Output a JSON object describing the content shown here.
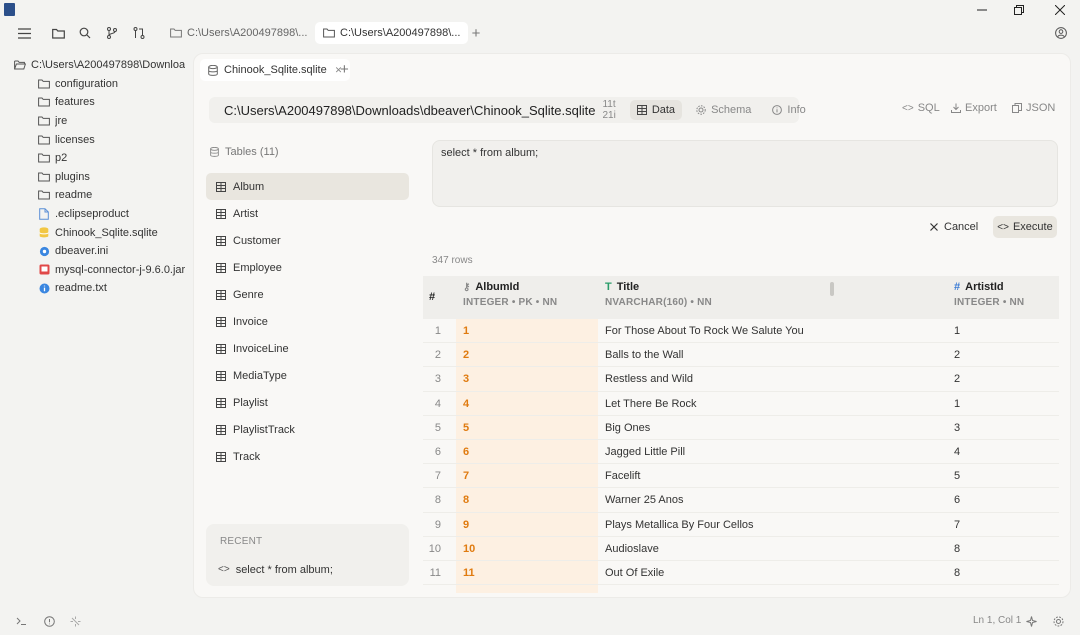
{
  "window": {
    "minimize": "–",
    "maximize": "❐",
    "close": "✕"
  },
  "toolbar": {
    "path_tabs": [
      {
        "label": "C:\\Users\\A200497898\\..."
      },
      {
        "label": "C:\\Users\\A200497898\\..."
      }
    ],
    "new_tab": "+"
  },
  "tree": {
    "root": "C:\\Users\\A200497898\\Downloa",
    "items": [
      {
        "label": "configuration",
        "icon": "folder-icon"
      },
      {
        "label": "features",
        "icon": "folder-icon"
      },
      {
        "label": "jre",
        "icon": "folder-icon"
      },
      {
        "label": "licenses",
        "icon": "folder-icon"
      },
      {
        "label": "p2",
        "icon": "folder-icon"
      },
      {
        "label": "plugins",
        "icon": "folder-icon"
      },
      {
        "label": "readme",
        "icon": "folder-icon"
      },
      {
        "label": ".eclipseproduct",
        "icon": "file-icon"
      },
      {
        "label": "Chinook_Sqlite.sqlite",
        "icon": "database-file-icon"
      },
      {
        "label": "dbeaver.ini",
        "icon": "settings-file-icon"
      },
      {
        "label": "mysql-connector-j-9.6.0.jar",
        "icon": "jar-file-icon"
      },
      {
        "label": "readme.txt",
        "icon": "info-file-icon"
      }
    ]
  },
  "doc": {
    "tab_label": "Chinook_Sqlite.sqlite",
    "tab_close": "✕",
    "new_tab": "+",
    "path": "C:\\Users\\A200497898\\Downloads\\dbeaver\\Chinook_Sqlite.sqlite",
    "path_meta": "11t 21i",
    "view_tabs": {
      "data": "Data",
      "schema": "Schema",
      "info": "Info"
    },
    "actions": {
      "sql": "SQL",
      "export": "Export",
      "json": "JSON"
    }
  },
  "tables": {
    "header": "Tables (11)",
    "items": [
      "Album",
      "Artist",
      "Customer",
      "Employee",
      "Genre",
      "Invoice",
      "InvoiceLine",
      "MediaType",
      "Playlist",
      "PlaylistTrack",
      "Track"
    ],
    "selected": "Album"
  },
  "recent": {
    "title": "RECENT",
    "items": [
      "select * from album;"
    ]
  },
  "editor": {
    "query": "select * from album;",
    "cancel_label": "Cancel",
    "execute_label": "Execute"
  },
  "results": {
    "row_count": "347 rows",
    "columns": [
      {
        "name": "#",
        "type": ""
      },
      {
        "name": "AlbumId",
        "type": "INTEGER • PK • NN",
        "icon": "key-icon"
      },
      {
        "name": "Title",
        "type": "NVARCHAR(160) • NN",
        "icon": "text-type-icon"
      },
      {
        "name": "ArtistId",
        "type": "INTEGER • NN",
        "icon": "hash-icon"
      }
    ],
    "rows": [
      {
        "n": "1",
        "id": "1",
        "title": "For Those About To Rock We Salute You",
        "artist": "1"
      },
      {
        "n": "2",
        "id": "2",
        "title": "Balls to the Wall",
        "artist": "2"
      },
      {
        "n": "3",
        "id": "3",
        "title": "Restless and Wild",
        "artist": "2"
      },
      {
        "n": "4",
        "id": "4",
        "title": "Let There Be Rock",
        "artist": "1"
      },
      {
        "n": "5",
        "id": "5",
        "title": "Big Ones",
        "artist": "3"
      },
      {
        "n": "6",
        "id": "6",
        "title": "Jagged Little Pill",
        "artist": "4"
      },
      {
        "n": "7",
        "id": "7",
        "title": "Facelift",
        "artist": "5"
      },
      {
        "n": "8",
        "id": "8",
        "title": "Warner 25 Anos",
        "artist": "6"
      },
      {
        "n": "9",
        "id": "9",
        "title": "Plays Metallica By Four Cellos",
        "artist": "7"
      },
      {
        "n": "10",
        "id": "10",
        "title": "Audioslave",
        "artist": "8"
      },
      {
        "n": "11",
        "id": "11",
        "title": "Out Of Exile",
        "artist": "8"
      }
    ]
  },
  "status": {
    "cursor": "Ln 1, Col 1"
  },
  "colors": {
    "accent_orange": "#e07b10",
    "pk_column_bg": "#fdf0e2",
    "selected_bg": "#e9e6df"
  }
}
